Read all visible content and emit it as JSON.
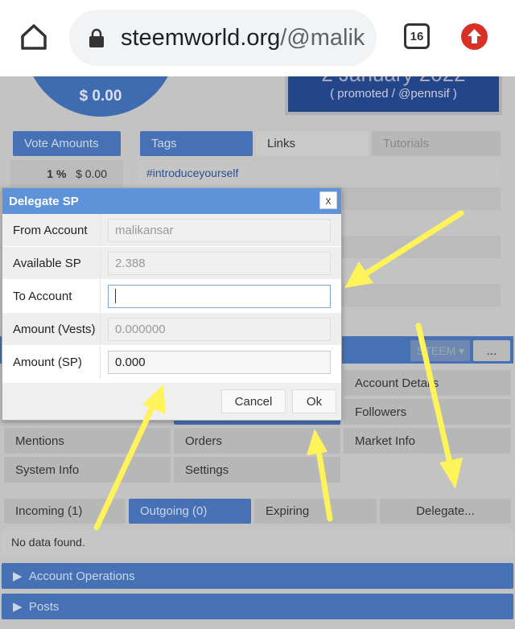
{
  "browser": {
    "url_main": "steemworld.org",
    "url_rest": "/@malik",
    "tab_count": "16",
    "icons": [
      "home-icon",
      "lock-icon",
      "tab-switcher-icon",
      "update-icon"
    ]
  },
  "gauge": {
    "value": "$ 0.00"
  },
  "promo": {
    "date": "2 January 2022",
    "note": "( promoted / @pennsif )"
  },
  "vote": {
    "header": "Vote Amounts",
    "percent": "1 %",
    "amount": "$ 0.00"
  },
  "tags": {
    "tabs": [
      "Tags",
      "Links",
      "Tutorials"
    ],
    "items": [
      "#introduceyourself"
    ]
  },
  "toolbar": {
    "currency": "STEEM",
    "more": "..."
  },
  "menu": [
    "Account Details",
    "Followers",
    "Mentions",
    "Orders",
    "Market Info",
    "System Info",
    "Settings"
  ],
  "deleg_tabs": [
    "Incoming (1)",
    "Outgoing (0)",
    "Expiring",
    "Delegate..."
  ],
  "no_data": "No data found.",
  "sections": [
    "Account Operations",
    "Posts"
  ],
  "dialog": {
    "title": "Delegate SP",
    "close": "x",
    "fields": [
      {
        "label": "From Account",
        "value": "malikansar"
      },
      {
        "label": "Available SP",
        "value": "2.388"
      },
      {
        "label": "To Account",
        "value": ""
      },
      {
        "label": "Amount (Vests)",
        "value": "0.000000"
      },
      {
        "label": "Amount (SP)",
        "value": "0.000"
      }
    ],
    "cancel": "Cancel",
    "ok": "Ok"
  },
  "colors": {
    "accent": "#4672b5",
    "dialog_header": "#5f93d9",
    "arrow": "#fff35a"
  }
}
